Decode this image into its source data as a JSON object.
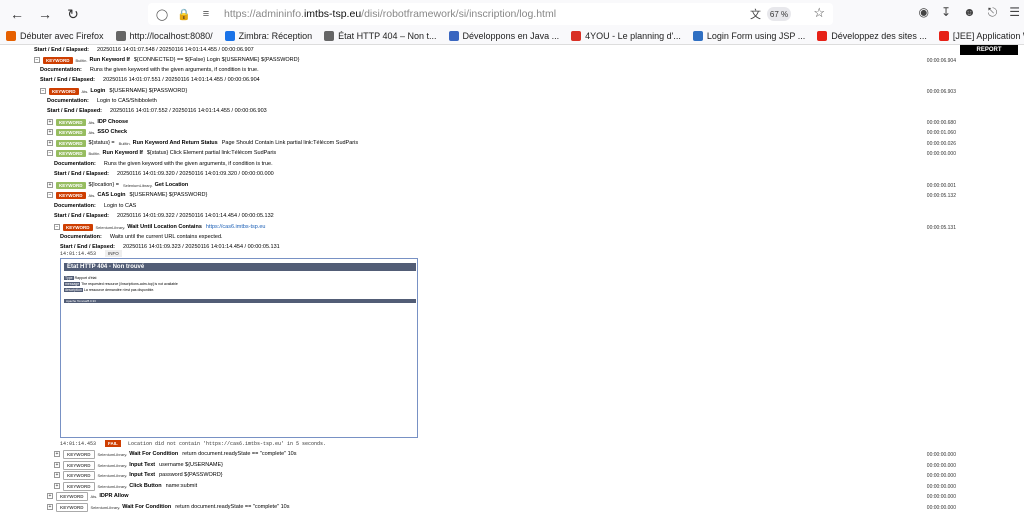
{
  "browser": {
    "url_prefix": "https://admininfo.",
    "url_domain": "imtbs-tsp.eu",
    "url_path": "/disi/robotframework/si/inscription/log.html",
    "zoom": "67 %",
    "bookmarks": [
      {
        "label": "Débuter avec Firefox",
        "color": "#e66000",
        "icon": "firefox-icon"
      },
      {
        "label": "http://localhost:8080/",
        "color": "#666",
        "icon": "globe-icon"
      },
      {
        "label": "Zimbra: Réception",
        "color": "#1a73e8",
        "icon": "zimbra-icon"
      },
      {
        "label": "État HTTP 404 – Non t...",
        "color": "#666",
        "icon": "globe-icon"
      },
      {
        "label": "Développons en Java ...",
        "color": "#3a66c0",
        "icon": "java-icon"
      },
      {
        "label": "4YOU - Le planning d'...",
        "color": "#d93025",
        "icon": "4you-icon"
      },
      {
        "label": "Login Form using JSP ...",
        "color": "#2f6fc2",
        "icon": "jsp-icon"
      },
      {
        "label": "Développez des sites ...",
        "color": "#e62117",
        "icon": "youtube-icon"
      },
      {
        "label": "[JEE] Application Web...",
        "color": "#e62117",
        "icon": "youtube-icon"
      }
    ]
  },
  "report_tab": "REPORT",
  "log": {
    "r0_label": "Start / End / Elapsed:",
    "r0_value": "20250116 14:01:07.548 / 20250116 14:01:14.455 / 00:00:06.907",
    "r1_kw": "KEYWORD",
    "r1_lib": "Builtin.",
    "r1_name": "Run Keyword If",
    "r1_args": "${CONNECTED} == ${False}    Login    ${USERNAME}    ${PASSWORD}",
    "r1_time": "00:00:06.904",
    "r2_label": "Documentation:",
    "r2_value": "Runs the given keyword with the given arguments, if condition is true.",
    "r3_label": "Start / End / Elapsed:",
    "r3_value": "20250116 14:01:07.551 / 20250116 14:01:14.455 / 00:00:06.904",
    "r4_kw": "KEYWORD",
    "r4_lib": "Ats.",
    "r4_name": "Login",
    "r4_args": "${USERNAME}    ${PASSWORD}",
    "r4_time": "00:00:06.903",
    "r5_label": "Documentation:",
    "r5_value": "Login to CAS/Shibboleth",
    "r6_label": "Start / End / Elapsed:",
    "r6_value": "20250116 14:01:07.552 / 20250116 14:01:14.455 / 00:00:06.903",
    "r7_kw": "KEYWORD",
    "r7_lib": "Ats.",
    "r7_name": "IDP Choose",
    "r7_time": "00:00:00.680",
    "r8_kw": "KEYWORD",
    "r8_lib": "Ats.",
    "r8_name": "SSO Check",
    "r8_time": "00:00:01.060",
    "r9_kw": "KEYWORD",
    "r9_pre": "${status} =",
    "r9_lib": "Builtin.",
    "r9_name": "Run Keyword And Return Status",
    "r9_args": "Page Should Contain Link    partial link:Télécom SudParis",
    "r9_time": "00:00:00.026",
    "r10_kw": "KEYWORD",
    "r10_lib": "Builtin.",
    "r10_name": "Run Keyword If",
    "r10_args": "${status}    Click Element    partial link:Télécom SudParis",
    "r10_time": "00:00:00.000",
    "r11_label": "Documentation:",
    "r11_value": "Runs the given keyword with the given arguments, if condition is true.",
    "r12_label": "Start / End / Elapsed:",
    "r12_value": "20250116 14:01:09.320 / 20250116 14:01:09.320 / 00:00:00.000",
    "r13_kw": "KEYWORD",
    "r13_pre": "${location} =",
    "r13_lib": "SeleniumLibrary.",
    "r13_name": "Get Location",
    "r13_time": "00:00:00.001",
    "r14_kw": "KEYWORD",
    "r14_lib": "Ats.",
    "r14_name": "CAS Login",
    "r14_args": "${USERNAME}    ${PASSWORD}",
    "r14_time": "00:00:05.132",
    "r15_label": "Documentation:",
    "r15_value": "Login to CAS",
    "r16_label": "Start / End / Elapsed:",
    "r16_value": "20250116 14:01:09.322 / 20250116 14:01:14.454 / 00:00:05.132",
    "r17_kw": "KEYWORD",
    "r17_lib": "SeleniumLibrary.",
    "r17_name": "Wait Until Location Contains",
    "r17_args": "https://cas6.imtbs-tsp.eu",
    "r17_time": "00:00:05.131",
    "r18_label": "Documentation:",
    "r18_value": "Waits until the current URL contains expected.",
    "r19_label": "Start / End / Elapsed:",
    "r19_value": "20250116 14:01:09.323 / 20250116 14:01:14.454 / 00:00:05.131",
    "msg1_ts": "14:01:14.453",
    "msg1_lvl": "INFO",
    "embed_title": "État HTTP 404 - Non trouvé",
    "embed_type_label": "Type",
    "embed_type_value": "Rapport d'état",
    "embed_msg_label": "message",
    "embed_msg_value": "The requested resource [/inscriptions-adm-top] is not available",
    "embed_desc_label": "description",
    "embed_desc_value": "La ressource demandée n'est pas disponible.",
    "embed_footer": "Apache Tomcat/8.0.33",
    "msg2_ts": "14:01:14.453",
    "msg2_lvl": "FAIL",
    "msg2_text": "Location did not contain 'https://cas6.imtbs-tsp.eu' in 5 seconds.",
    "r20_kw": "KEYWORD",
    "r20_lib": "SeleniumLibrary.",
    "r20_name": "Wait For Condition",
    "r20_args": "return document.readyState == \"complete\"    10s",
    "r20_time": "00:00:00.000",
    "r21_kw": "KEYWORD",
    "r21_lib": "SeleniumLibrary.",
    "r21_name": "Input Text",
    "r21_args": "username    ${USERNAME}",
    "r21_time": "00:00:00.000",
    "r22_kw": "KEYWORD",
    "r22_lib": "SeleniumLibrary.",
    "r22_name": "Input Text",
    "r22_args": "password    ${PASSWORD}",
    "r22_time": "00:00:00.000",
    "r23_kw": "KEYWORD",
    "r23_lib": "SeleniumLibrary.",
    "r23_name": "Click Button",
    "r23_args": "name:submit",
    "r23_time": "00:00:00.000",
    "r24_kw": "KEYWORD",
    "r24_lib": "Ats.",
    "r24_name": "IDPR Allow",
    "r24_time": "00:00:00.000",
    "r25_kw": "KEYWORD",
    "r25_lib": "SeleniumLibrary.",
    "r25_name": "Wait For Condition",
    "r25_args": "return document.readyState == \"complete\"    10s",
    "r25_time": "00:00:00.000"
  }
}
